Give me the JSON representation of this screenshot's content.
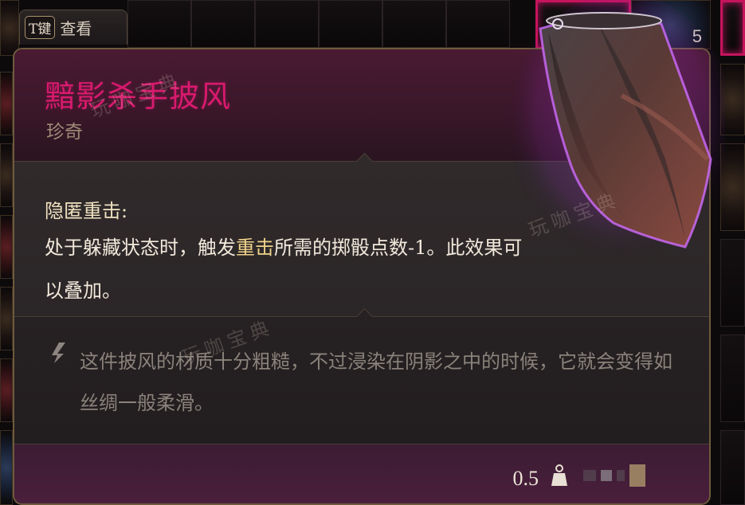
{
  "key_hint": {
    "key": "T键",
    "action": "查看"
  },
  "inventory": {
    "stack_count": "5"
  },
  "tooltip": {
    "item_name": "黯影杀手披风",
    "rarity": "珍奇",
    "ability_title": "隐匿重击:",
    "ability_desc_part1": "处于躲藏状态时，触发",
    "ability_desc_highlight": "重击",
    "ability_desc_part2": "所需的掷骰点数-1。此效果可以叠加。",
    "flavor_text": "这件披风的材质十分粗糙，不过浸染在阴影之中的时候，它就会变得如丝绸一般柔滑。",
    "weight": "0.5"
  },
  "watermarks": [
    "玩咖宝典",
    "玩咖宝典",
    "玩咖宝典"
  ],
  "colors": {
    "item_name": "#d81a6e",
    "rarity": "#9e8a76",
    "highlight": "#f0d38a",
    "selected_border": "#c5145c"
  },
  "icons": [
    "quote-icon",
    "weight-icon"
  ]
}
